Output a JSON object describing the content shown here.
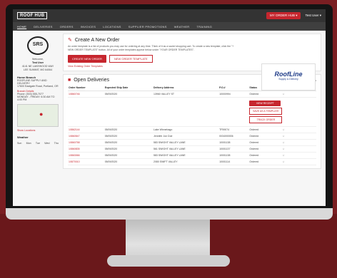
{
  "header": {
    "logo": "ROOF HUB",
    "order_hub": "MY ORDER HUB ▾",
    "user": "Test User ▾"
  },
  "nav": [
    "HOME",
    "DELIVERIES",
    "ORDERS",
    "INVOICES",
    "LOCATIONS",
    "SUPPLIER PROMOTIONS",
    "WEATHER",
    "TRAINING"
  ],
  "sidebar": {
    "logo": "SRS",
    "welcome": "Welcome,",
    "name": "Test User",
    "address1": "4141 NE LAKEWOOD WAY",
    "address2": "LEE SUMMIT, MO 64064",
    "home_branch": "Home Branch",
    "branch_name": "ROOFLINE SUPPLY AND DELIVERY",
    "branch_addr": "17600 Eastgate Road, Portland, OR",
    "branch_details": "Branch Details",
    "phone": "Phone: (503) 555-7077",
    "hours": "MONDAY - FRIDAY: 6:30 AM TO 4:00 PM",
    "show_locations": "Show Locations",
    "weather_title": "Weather",
    "weather_days": [
      "Sun",
      "Mon",
      "Tue",
      "Wed",
      "Thu"
    ]
  },
  "create_order": {
    "title": "Create A New Order",
    "desc": "An order template is a list of products you may use for ordering at any time. Think of it as a saved shopping cart. To create a new template, click the \"+ NEW ORDER TEMPLATE\" button. All of your order templates appear below under \"YOUR ORDER TEMPLATES\".",
    "btn_new_order": "CREATE NEW ORDER",
    "btn_new_template": "NEW ORDER TEMPLATE",
    "link": "View Existing Order Templates",
    "brand": "RoofLine",
    "brand_sub": "Supply & Delivery"
  },
  "deliveries": {
    "title": "Open Deliveries",
    "toggle": "Show Only Favorites",
    "columns": [
      "Order Number",
      "Expected Ship Date",
      "Delivery Address",
      "P.O.#",
      "Status",
      "Favorite"
    ],
    "rows": [
      {
        "num": "10860746",
        "date": "05/09/2020",
        "addr": "13960 VALLEY ST",
        "po": "10000994",
        "status": "Ordered"
      },
      {
        "num": "10862144",
        "date": "05/09/2020",
        "addr": "Lake Winnebago",
        "po": "TF59074",
        "status": "Ordered"
      },
      {
        "num": "10860547",
        "date": "05/09/2020",
        "addr": "Jennifer Jon Doe",
        "po": "0034000006",
        "status": "Ordered"
      },
      {
        "num": "10860758",
        "date": "05/09/2020",
        "addr": "583 SWIGHT VALLEY LANE",
        "po": "10001138",
        "status": "Ordered"
      },
      {
        "num": "10860835",
        "date": "05/09/2020",
        "addr": "561 SWIGHT VALLEY LANE",
        "po": "10001137",
        "status": "Ordered"
      },
      {
        "num": "10863066",
        "date": "05/09/2020",
        "addr": "583 SWIGHT VALLEY LANE",
        "po": "10001138",
        "status": "Ordered"
      },
      {
        "num": "10870010",
        "date": "05/09/2020",
        "addr": "2080 SWIFT VALLEY",
        "po": "10001114",
        "status": "Ordered"
      }
    ],
    "buttons": [
      "VIEW RECEIPT",
      "SAVE AS A TEMPLATE",
      "TRACK ORDER"
    ]
  }
}
